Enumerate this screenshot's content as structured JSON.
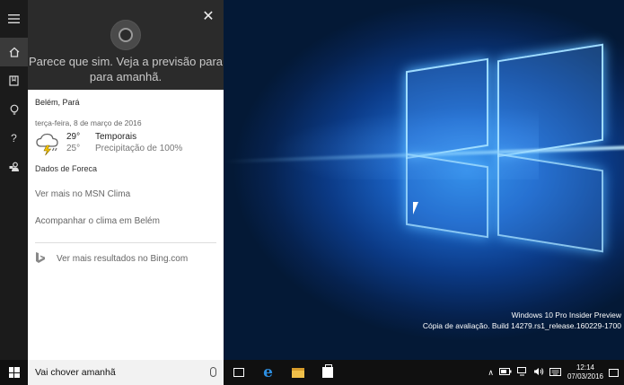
{
  "cortana": {
    "speech": "Parece que sim. Veja a previsão para para amanhã.",
    "location": "Belém, Pará",
    "date": "terça-feira, 8 de março de 2016",
    "high": "29°",
    "low": "25°",
    "condition": "Temporais",
    "precipitation": "Precipitação de 100%",
    "source": "Dados de Foreca",
    "link_msn": "Ver mais no MSN Clima",
    "link_follow": "Acompanhar o clima em Belém",
    "bing_more": "Ver mais resultados no Bing.com",
    "icons": [
      "hamburger-icon",
      "home-icon",
      "notebook-icon",
      "lightbulb-icon",
      "help-icon",
      "feedback-icon",
      "close-icon",
      "storm-icon",
      "bing-icon",
      "microphone-icon"
    ]
  },
  "taskbar": {
    "search_text": "Vai chover amanhã",
    "time": "12:14",
    "date": "07/03/2016",
    "icons": [
      "windows-start-icon",
      "task-view-icon",
      "edge-icon",
      "file-explorer-icon",
      "store-icon",
      "chevron-up-icon",
      "battery-icon",
      "network-icon",
      "volume-icon",
      "keyboard-icon",
      "notification-icon"
    ]
  },
  "desktop": {
    "watermark_line1": "Windows 10 Pro Insider Preview",
    "watermark_line2": "Cópia de avaliação. Build 14279.rs1_release.160229-1700"
  },
  "colors": {
    "rail": "#1b1b1b",
    "panel_header": "#2b2b2b",
    "taskbar": "#101010",
    "edge_blue": "#2d8ee0"
  }
}
